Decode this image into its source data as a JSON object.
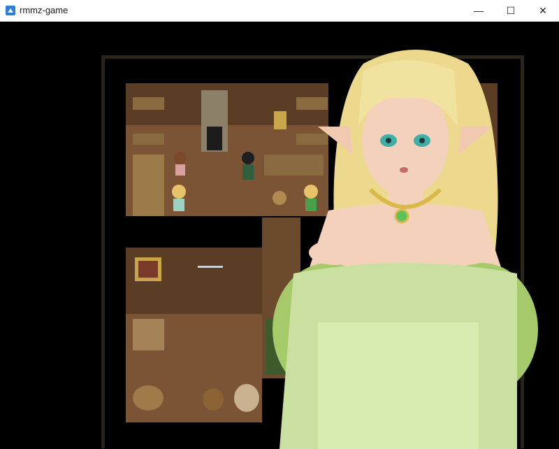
{
  "window": {
    "title": "rmmz-game",
    "app_icon": "rpg-maker-icon",
    "controls": {
      "minimize_icon": "minimize-icon",
      "maximize_icon": "maximize-icon",
      "close_icon": "close-icon",
      "minimize_glyph": "—",
      "maximize_glyph": "☐",
      "close_glyph": "✕"
    }
  },
  "scene": {
    "type": "interior-map",
    "colors": {
      "wall_frame": "#8b8470",
      "wood_floor": "#7a5434",
      "wall_panel": "#5a3d24",
      "green_rug": "#3f5a2a"
    },
    "npcs": [
      "brown-haired-girl",
      "blonde-girl",
      "dark-haired-man",
      "blonde-elf-back"
    ],
    "portrait": "blonde-elf-woman-portrait"
  }
}
